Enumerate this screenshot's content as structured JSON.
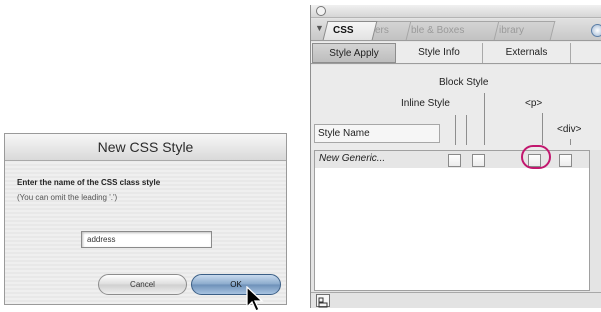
{
  "dialog": {
    "title": "New CSS Style",
    "prompt": "Enter the name of the CSS class style",
    "hint": "(You can omit the leading '.')",
    "input_value": "address",
    "cancel_label": "Cancel",
    "ok_label": "OK"
  },
  "panel": {
    "tabs": [
      {
        "label": "CSS"
      },
      {
        "label": "ers"
      },
      {
        "label": "ble & Boxes"
      },
      {
        "label": "ibrary"
      }
    ],
    "subtabs": [
      {
        "label": "Style Apply"
      },
      {
        "label": "Style Info"
      },
      {
        "label": "Externals"
      }
    ],
    "headers": {
      "block_style": "Block Style",
      "inline_style": "Inline Style",
      "p_tag": "<p>",
      "div_tag": "<div>",
      "style_name": "Style Name"
    },
    "rows": [
      {
        "name": "New Generic..."
      }
    ]
  },
  "colors": {
    "highlight_ring": "#c2176e",
    "ok_button": "#7f9fc4"
  },
  "icons": [
    "close-icon",
    "panel-menu-icon",
    "panel-options-icon",
    "attach-style-icon",
    "mouse-cursor-icon"
  ]
}
